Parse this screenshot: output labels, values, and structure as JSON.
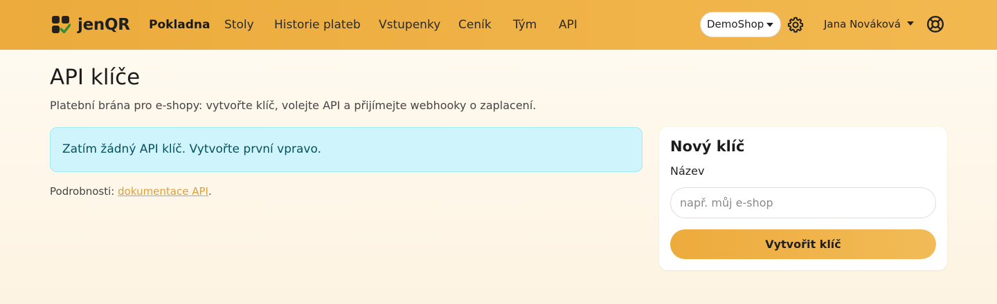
{
  "brand": {
    "name": "jenQR"
  },
  "nav": {
    "items": [
      {
        "label": "Pokladna",
        "active": true
      },
      {
        "label": "Stoly"
      },
      {
        "label": "Historie plateb"
      },
      {
        "label": "Vstupenky"
      },
      {
        "label": "Ceník"
      },
      {
        "label": "Tým"
      },
      {
        "label": "API"
      }
    ]
  },
  "shop_select": {
    "value": "DemoShop"
  },
  "user": {
    "name": "Jana Nováková"
  },
  "icons": {
    "settings": "gear-icon",
    "help": "lifebuoy-icon",
    "logo": "qr-check-logo"
  },
  "page": {
    "title": "API klíče",
    "subtitle": "Platební brána pro e-shopy: vytvořte klíč, volejte API a přijímejte webhooky o zaplacení."
  },
  "alert": {
    "text": "Zatím žádný API klíč. Vytvořte první vpravo."
  },
  "details": {
    "prefix": "Podrobnosti:",
    "link": "dokumentace API",
    "suffix": "."
  },
  "new_key": {
    "title": "Nový klíč",
    "label": "Název",
    "placeholder": "např. můj e-shop",
    "button": "Vytvořit klíč"
  },
  "colors": {
    "navbar": "#ecab3c",
    "accent": "#f2b84f",
    "alert_bg": "#cff4fc",
    "alert_text": "#055160",
    "link": "#dba03a"
  }
}
